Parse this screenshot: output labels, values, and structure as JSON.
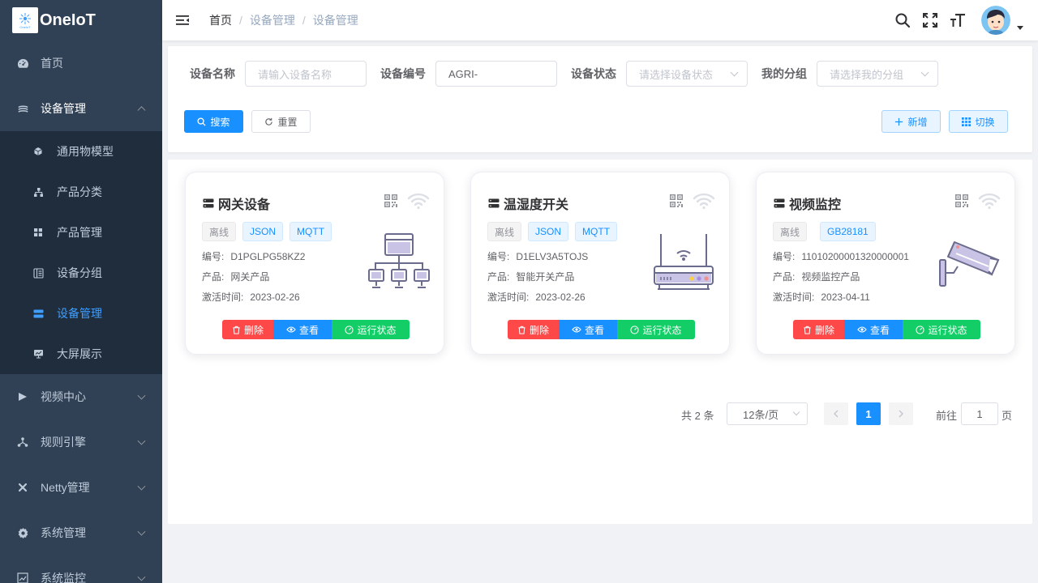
{
  "app": {
    "logo_small": "OneIoT",
    "title": "OneIoT"
  },
  "sidebar": {
    "items": [
      {
        "label": "首页",
        "icon": "dashboard-icon"
      },
      {
        "label": "设备管理",
        "icon": "layers-icon",
        "expanded": true
      },
      {
        "label": "视频中心",
        "icon": "video-icon"
      },
      {
        "label": "规则引擎",
        "icon": "network-icon"
      },
      {
        "label": "Netty管理",
        "icon": "tools-icon"
      },
      {
        "label": "系统管理",
        "icon": "gear-icon"
      },
      {
        "label": "系统监控",
        "icon": "monitor-icon"
      }
    ],
    "sub_items": [
      {
        "label": "通用物模型",
        "icon": "cube-icon"
      },
      {
        "label": "产品分类",
        "icon": "tree-icon"
      },
      {
        "label": "产品管理",
        "icon": "grid-icon"
      },
      {
        "label": "设备分组",
        "icon": "group-icon"
      },
      {
        "label": "设备管理",
        "icon": "list-icon",
        "active": true
      },
      {
        "label": "大屏展示",
        "icon": "screen-icon"
      }
    ]
  },
  "header": {
    "breadcrumb": [
      "首页",
      "设备管理",
      "设备管理"
    ],
    "icons": [
      "search-icon",
      "fullscreen-icon",
      "font-size-icon"
    ]
  },
  "filters": {
    "device_name": {
      "label": "设备名称",
      "value": "",
      "placeholder": "请输入设备名称"
    },
    "device_no": {
      "label": "设备编号",
      "value": "AGRI-",
      "placeholder": ""
    },
    "device_status": {
      "label": "设备状态",
      "value": "",
      "placeholder": "请选择设备状态"
    },
    "my_group": {
      "label": "我的分组",
      "value": "",
      "placeholder": "请选择我的分组"
    },
    "search_btn": "搜索",
    "reset_btn": "重置",
    "add_btn": "新增",
    "switch_btn": "切换"
  },
  "cards": [
    {
      "title": "网关设备",
      "tags": [
        "离线",
        "JSON",
        "MQTT"
      ],
      "no_label": "编号:",
      "no": "D1PGLPG58KZ2",
      "product_label": "产品:",
      "product": "网关产品",
      "time_label": "激活时间:",
      "time": "2023-02-26",
      "image": "gateway-icon"
    },
    {
      "title": "温湿度开关",
      "tags": [
        "离线",
        "JSON",
        "MQTT"
      ],
      "no_label": "编号:",
      "no": "D1ELV3A5TOJS",
      "product_label": "产品:",
      "product": "智能开关产品",
      "time_label": "激活时间:",
      "time": "2023-02-26",
      "image": "router-icon"
    },
    {
      "title": "视频监控",
      "tags": [
        "离线",
        "GB28181"
      ],
      "no_label": "编号:",
      "no": "11010200001320000001",
      "product_label": "产品:",
      "product": "视频监控产品",
      "time_label": "激活时间:",
      "time": "2023-04-11",
      "image": "camera-icon"
    }
  ],
  "card_actions": {
    "delete": "删除",
    "view": "查看",
    "status": "运行状态"
  },
  "pagination": {
    "total": "共 2 条",
    "page_size": "12条/页",
    "current": "1",
    "goto_label": "前往",
    "goto_value": "1",
    "page_suffix": "页"
  },
  "colors": {
    "sidebar_bg": "#304156",
    "submenu_bg": "#1f2d3d",
    "primary": "#1890ff",
    "danger": "#ff4949",
    "success": "#13ce66"
  }
}
